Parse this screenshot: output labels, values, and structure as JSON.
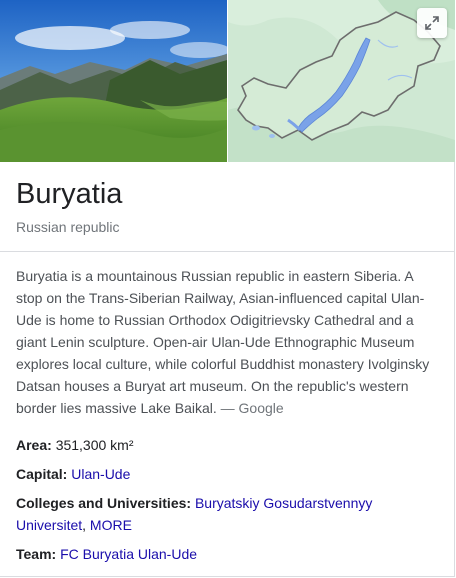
{
  "knowledge_panel": {
    "title": "Buryatia",
    "subtitle": "Russian republic",
    "media": {
      "photo_alt": "Buryatia",
      "map_alt": "Map of Buryatia",
      "expand_icon": "expand-icon"
    },
    "description": "Buryatia is a mountainous Russian republic in eastern Siberia. A stop on the Trans-Siberian Railway, Asian-influenced capital Ulan-Ude is home to Russian Orthodox Odigitrievsky Cathedral and a giant Lenin sculpture. Open-air Ulan-Ude Ethnographic Museum explores local culture, while colorful Buddhist monastery Ivolginsky Datsan houses a Buryat art museum. On the republic's western border lies massive Lake Baikal.",
    "description_source": "— Google",
    "facts": {
      "area": {
        "label": "Area:",
        "value": "351,300 km²"
      },
      "capital": {
        "label": "Capital:",
        "value": "Ulan-Ude"
      },
      "colleges": {
        "label": "Colleges and Universities:",
        "link1": "Buryatskiy Gosudarstvennyy Universitet",
        "separator": ", ",
        "link2": "MORE"
      },
      "team": {
        "label": "Team:",
        "value": "FC Buryatia Ulan-Ude"
      }
    },
    "colors": {
      "link": "#1a0dab",
      "title": "#202124",
      "muted": "#70757a",
      "body": "#4d5156",
      "divider": "#dadce0"
    }
  }
}
